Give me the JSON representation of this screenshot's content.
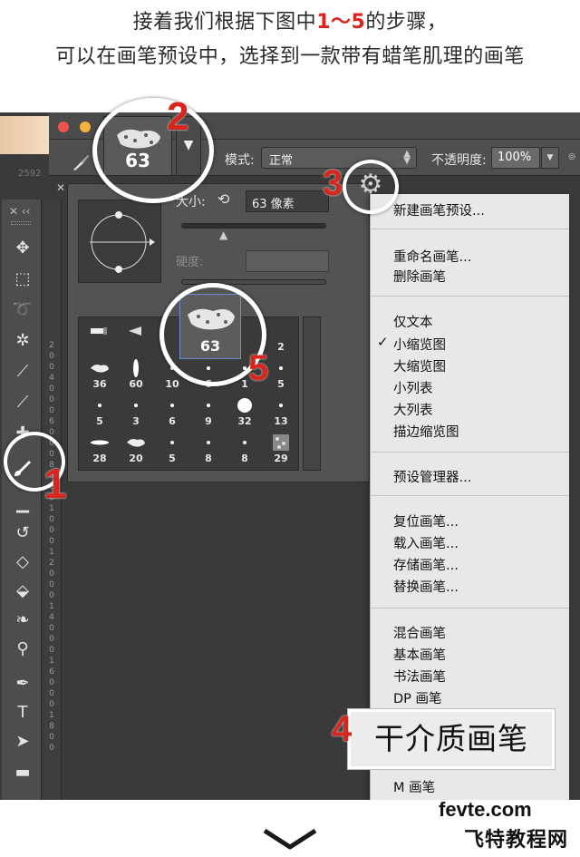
{
  "caption": {
    "line1_pre": "接着我们根据下图中",
    "line1_range": "1～5",
    "line1_post": "的步骤，",
    "line2": "可以在画笔预设中，选择到一款带有蜡笔肌理的画笔"
  },
  "options_bar": {
    "brush_size": "63",
    "mode_label": "模式:",
    "mode_value": "正常",
    "opacity_label": "不透明度:",
    "opacity_value": "100%",
    "ruler_value": "2592"
  },
  "picker": {
    "size_label": "大小:",
    "size_value": "63 像素",
    "hardness_label": "硬度:",
    "selected_value": "63",
    "grid_rows": [
      [
        "",
        "",
        "",
        "",
        "",
        "2"
      ],
      [
        "36",
        "60",
        "10",
        "6",
        "1",
        "5"
      ],
      [
        "5",
        "3",
        "6",
        "9",
        "32",
        "13"
      ],
      [
        "28",
        "20",
        "5",
        "8",
        "8",
        "29"
      ]
    ]
  },
  "steps": {
    "s1": "1",
    "s2": "2",
    "s3": "3",
    "s4": "4",
    "s5": "5"
  },
  "menu": {
    "new_preset": "新建画笔预设...",
    "rename": "重命名画笔...",
    "delete": "删除画笔",
    "text_only": "仅文本",
    "small_thumb": "小缩览图",
    "large_thumb": "大缩览图",
    "small_list": "小列表",
    "large_list": "大列表",
    "stroke_thumb": "描边缩览图",
    "preset_manager": "预设管理器...",
    "reset": "复位画笔...",
    "load": "载入画笔...",
    "save": "存储画笔...",
    "replace": "替换画笔...",
    "mixed": "混合画笔",
    "basic": "基本画笔",
    "calligraphic": "书法画笔",
    "dp": "DP 画笔",
    "m": "M 画笔",
    "checked_mark": "✓"
  },
  "callout": "干介质画笔",
  "vruler_labels": [
    "2",
    "0",
    "0",
    "4",
    "0",
    "0",
    "0",
    "6",
    "0",
    "0",
    "0",
    "8",
    "0",
    "0",
    "0",
    "1",
    "0",
    "0",
    "0",
    "1",
    "2",
    "0",
    "0",
    "0",
    "1",
    "4",
    "0",
    "0",
    "0",
    "1",
    "6",
    "0",
    "0",
    "0",
    "1",
    "8",
    "0",
    "0"
  ],
  "watermark": {
    "line1": "fevte.com",
    "line2": "飞特教程网"
  },
  "icons": {
    "gear": "gear-icon",
    "brush": "brush-icon",
    "dropdown": "chevron-down-icon"
  },
  "colors": {
    "accent_red": "#d6261e",
    "panel_dark": "#3a3a3a",
    "menu_bg": "#e8e8e8"
  }
}
